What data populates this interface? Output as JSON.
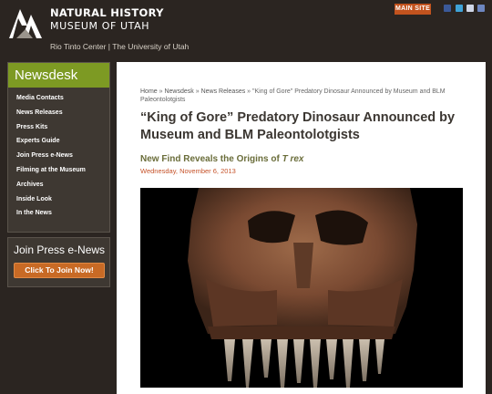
{
  "header": {
    "logo_title": "NATURAL HISTORY",
    "logo_subtitle": "MUSEUM OF UTAH",
    "logo_tagline": "Rio Tinto Center | The University of Utah",
    "main_site_label": "MAIN SITE",
    "social_icons": [
      "facebook-icon",
      "twitter-icon",
      "youtube-icon",
      "rss-icon"
    ]
  },
  "sidebar": {
    "heading": "Newsdesk",
    "items": [
      {
        "label": "Media Contacts"
      },
      {
        "label": "News Releases"
      },
      {
        "label": "Press Kits"
      },
      {
        "label": "Experts Guide"
      },
      {
        "label": "Join Press e-News"
      },
      {
        "label": "Filming at the Museum"
      },
      {
        "label": "Archives"
      },
      {
        "label": "Inside Look"
      },
      {
        "label": "In the News"
      }
    ],
    "press_title": "Join Press e-News",
    "join_button": "Click To Join Now!"
  },
  "main": {
    "breadcrumb": [
      "Home",
      "Newsdesk",
      "News Releases",
      "\"King of Gore\" Predatory Dinosaur Announced by Museum and BLM Paleontolotgists"
    ],
    "title": "“King of Gore” Predatory Dinosaur Announced by Museum and BLM Paleontolotgists",
    "subtitle_text": "New Find Reveals the Origins of ",
    "subtitle_italic": "T rex",
    "date": "Wednesday, November 6, 2013"
  },
  "colors": {
    "header_bg": "#2b2521",
    "nav_green": "#7d9a23",
    "main_site_orange": "#c2531e",
    "join_button": "#c86a25",
    "title_color": "#3b3631",
    "subtitle_color": "#6a6d3a",
    "date_color": "#c6532a"
  }
}
